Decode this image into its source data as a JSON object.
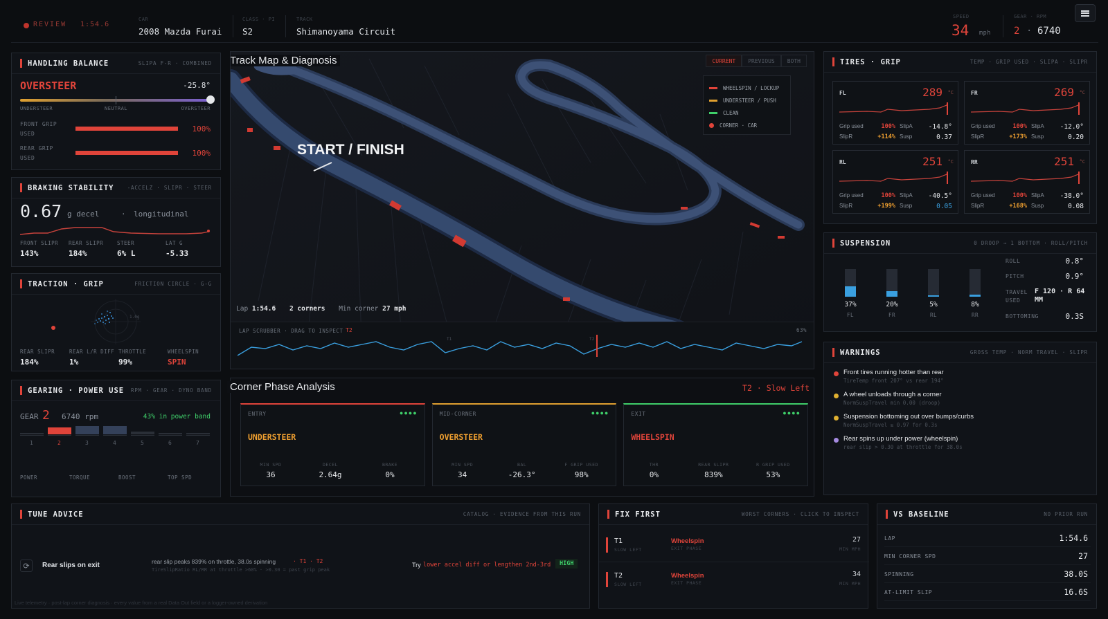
{
  "header": {
    "mode": "REVIEW",
    "lap_time": "1:54.6",
    "car_label": "CAR",
    "car": "2008 Mazda Furai",
    "class_label": "CLASS · PI",
    "class": "S2",
    "track_label": "TRACK",
    "track": "Shimanoyama Circuit",
    "speed_label": "SPEED",
    "speed": "34",
    "speed_unit": "mph",
    "gear_label": "GEAR · RPM",
    "gear": "2",
    "rpm": "6740",
    "sep": "·"
  },
  "handling": {
    "title": "HANDLING BALANCE",
    "meta": "SLIPA F-R · COMBINED",
    "state": "OVERSTEER",
    "angle": "-25.8°",
    "balance_pos": 1.0,
    "scale": [
      "UNDERSTEER",
      "NEUTRAL",
      "OVERSTEER"
    ],
    "front_label": "FRONT GRIP USED",
    "front_val": "100%",
    "front_frac": 1.0,
    "rear_label": "REAR GRIP USED",
    "rear_val": "100%",
    "rear_frac": 1.0
  },
  "braking": {
    "title": "BRAKING STABILITY",
    "meta": "-ACCELZ · SLIPR · STEER",
    "value": "0.67",
    "unit": "g decel",
    "sep": "·",
    "desc": "longitudinal",
    "stats": [
      {
        "label": "FRONT SLIPR",
        "value": "143%"
      },
      {
        "label": "REAR SLIPR",
        "value": "184%"
      },
      {
        "label": "STEER",
        "value": "6% L"
      },
      {
        "label": "LAT G",
        "value": "-5.33"
      }
    ]
  },
  "traction": {
    "title": "TRACTION · GRIP",
    "meta": "FRICTION CIRCLE · G-G",
    "ring_label": "1.0g",
    "stats": [
      {
        "label": "REAR SLIPR",
        "value": "184%"
      },
      {
        "label": "REAR L/R DIFF",
        "value": "1%"
      },
      {
        "label": "THROTTLE",
        "value": "99%"
      },
      {
        "label": "WHEELSPIN",
        "value": "SPIN"
      }
    ]
  },
  "gearing": {
    "title": "GEARING · POWER USE",
    "meta": "RPM · GEAR · DYNO BAND",
    "gear_label": "GEAR",
    "gear": "2",
    "rpm_text": "6740 rpm",
    "band": "43% in power band",
    "gears": [
      "1",
      "2",
      "3",
      "4",
      "5",
      "6",
      "7"
    ],
    "active_gear": 2,
    "stats": [
      "POWER",
      "TORQUE",
      "BOOST",
      "TOP SPD"
    ]
  },
  "trackmap": {
    "title": "Track Map & Diagnosis",
    "tabs": [
      "CURRENT",
      "PREVIOUS",
      "BOTH"
    ],
    "active_tab": "CURRENT",
    "legend": [
      {
        "label": "WHEELSPIN / LOCKUP",
        "color": "#e0443a"
      },
      {
        "label": "UNDERSTEER / PUSH",
        "color": "#e0a030"
      },
      {
        "label": "CLEAN",
        "color": "#3fcf6a"
      },
      {
        "label": "CORNER · CAR",
        "color": "#e0443a"
      }
    ],
    "sf_label": "START / FINISH",
    "lap_label": "Lap",
    "lap": "1:54.6",
    "corners": "2 corners",
    "min_corner_label": "Min corner",
    "min_corner": "27 mph"
  },
  "scrubber": {
    "label": "LAP SCRUBBER · DRAG TO INSPECT",
    "marker": "T2",
    "pct": "63%",
    "t1": "T1",
    "t2": "T2",
    "pos": 0.63
  },
  "corner_phase": {
    "title": "Corner Phase Analysis",
    "corner": "T2",
    "sep": "·",
    "corner_name": "Slow Left",
    "phases": [
      {
        "name": "ENTRY",
        "state": "UNDERSTEER",
        "color": "#f0a030",
        "line": "#e0443a",
        "stats": [
          {
            "label": "MIN SPD",
            "value": "36"
          },
          {
            "label": "DECEL",
            "value": "2.64g"
          },
          {
            "label": "BRAKE",
            "value": "0%"
          }
        ]
      },
      {
        "name": "MID-CORNER",
        "state": "OVERSTEER",
        "color": "#f0a030",
        "line": "#e0a030",
        "stats": [
          {
            "label": "MIN SPD",
            "value": "34"
          },
          {
            "label": "BAL",
            "value": "-26.3°"
          },
          {
            "label": "F GRIP USED",
            "value": "98%"
          }
        ]
      },
      {
        "name": "EXIT",
        "state": "WHEELSPIN",
        "color": "#e0443a",
        "line": "#3fcf6a",
        "stats": [
          {
            "label": "THR",
            "value": "0%"
          },
          {
            "label": "REAR SLIPR",
            "value": "839%"
          },
          {
            "label": "R GRIP USED",
            "value": "53%"
          }
        ]
      }
    ]
  },
  "tires": {
    "title": "TIRES · GRIP",
    "meta": "TEMP · GRIP USED · SLIPA · SLIPR",
    "unit": "°C",
    "labels": {
      "grip": "Grip used",
      "slipa": "SlipA",
      "slipr": "SlipR",
      "susp": "Susp"
    },
    "items": [
      {
        "pos": "FL",
        "temp": "289",
        "grip": "100%",
        "slipa": "-14.8°",
        "slipr": "+114%",
        "susp": "0.37"
      },
      {
        "pos": "FR",
        "temp": "269",
        "grip": "100%",
        "slipa": "-12.0°",
        "slipr": "+173%",
        "susp": "0.20"
      },
      {
        "pos": "RL",
        "temp": "251",
        "grip": "100%",
        "slipa": "-40.5°",
        "slipr": "+199%",
        "susp": "0.05"
      },
      {
        "pos": "RR",
        "temp": "251",
        "grip": "100%",
        "slipa": "-38.0°",
        "slipr": "+168%",
        "susp": "0.08"
      }
    ]
  },
  "suspension": {
    "title": "SUSPENSION",
    "meta": "0 DROOP → 1 BOTTOM · ROLL/PITCH",
    "bars": [
      {
        "pos": "FL",
        "pct": "37%",
        "frac": 0.37
      },
      {
        "pos": "FR",
        "pct": "20%",
        "frac": 0.2
      },
      {
        "pos": "RL",
        "pct": "5%",
        "frac": 0.05
      },
      {
        "pos": "RR",
        "pct": "8%",
        "frac": 0.08
      }
    ],
    "roll_label": "ROLL",
    "roll": "0.8°",
    "pitch_label": "PITCH",
    "pitch": "0.9°",
    "travel_label": "TRAVEL USED",
    "travel": "F 120 · R 64 MM",
    "bottoming_label": "BOTTOMING",
    "bottoming": "0.3S"
  },
  "warnings": {
    "title": "WARNINGS",
    "meta": "GROSS TEMP · NORM TRAVEL · SLIPR",
    "items": [
      {
        "text": "Front tires running hotter than rear",
        "sub": "TireTemp front 207° vs rear 194°",
        "color": "#e0443a"
      },
      {
        "text": "A wheel unloads through a corner",
        "sub": "NormSuspTravel min 0.00 (droop)",
        "color": "#e0b030"
      },
      {
        "text": "Suspension bottoming out over bumps/curbs",
        "sub": "NormSuspTravel ≥ 0.97 for 0.3s",
        "color": "#e0b030"
      },
      {
        "text": "Rear spins up under power (wheelspin)",
        "sub": "rear slip > 0.30 at throttle for 38.0s",
        "color": "#a58ae0"
      }
    ]
  },
  "tune": {
    "title": "TUNE ADVICE",
    "meta": "CATALOG · EVIDENCE FROM THIS RUN",
    "item": "Rear slips on exit",
    "evidence": "rear slip peaks 839% on throttle, 38.0s spinning",
    "evidence_tags": "· T1 · T2",
    "evidence_sub": "TireSlipRatio RL/RR at throttle >60% · >0.30 = past grip peak",
    "try_label": "Try",
    "try_text": "lower accel diff or lengthen 2nd-3rd",
    "badge": "HIGH",
    "footer": "Live telemetry · post-lap corner diagnosis · every value from a real Data Out field or a logger-owned derivation"
  },
  "fixfirst": {
    "title": "FIX FIRST",
    "meta": "WORST CORNERS · CLICK TO INSPECT",
    "items": [
      {
        "corner": "T1",
        "sub": "SLOW LEFT",
        "issue": "Wheelspin",
        "phase": "EXIT PHASE",
        "speed": "27",
        "unit": "MIN MPH"
      },
      {
        "corner": "T2",
        "sub": "SLOW LEFT",
        "issue": "Wheelspin",
        "phase": "EXIT PHASE",
        "speed": "34",
        "unit": "MIN MPH"
      }
    ]
  },
  "baseline": {
    "title": "VS BASELINE",
    "meta": "NO PRIOR RUN",
    "rows": [
      {
        "label": "LAP",
        "value": "1:54.6"
      },
      {
        "label": "MIN CORNER SPD",
        "value": "27"
      },
      {
        "label": "SPINNING",
        "value": "38.0S"
      },
      {
        "label": "AT-LIMIT SLIP",
        "value": "16.6S"
      }
    ]
  }
}
